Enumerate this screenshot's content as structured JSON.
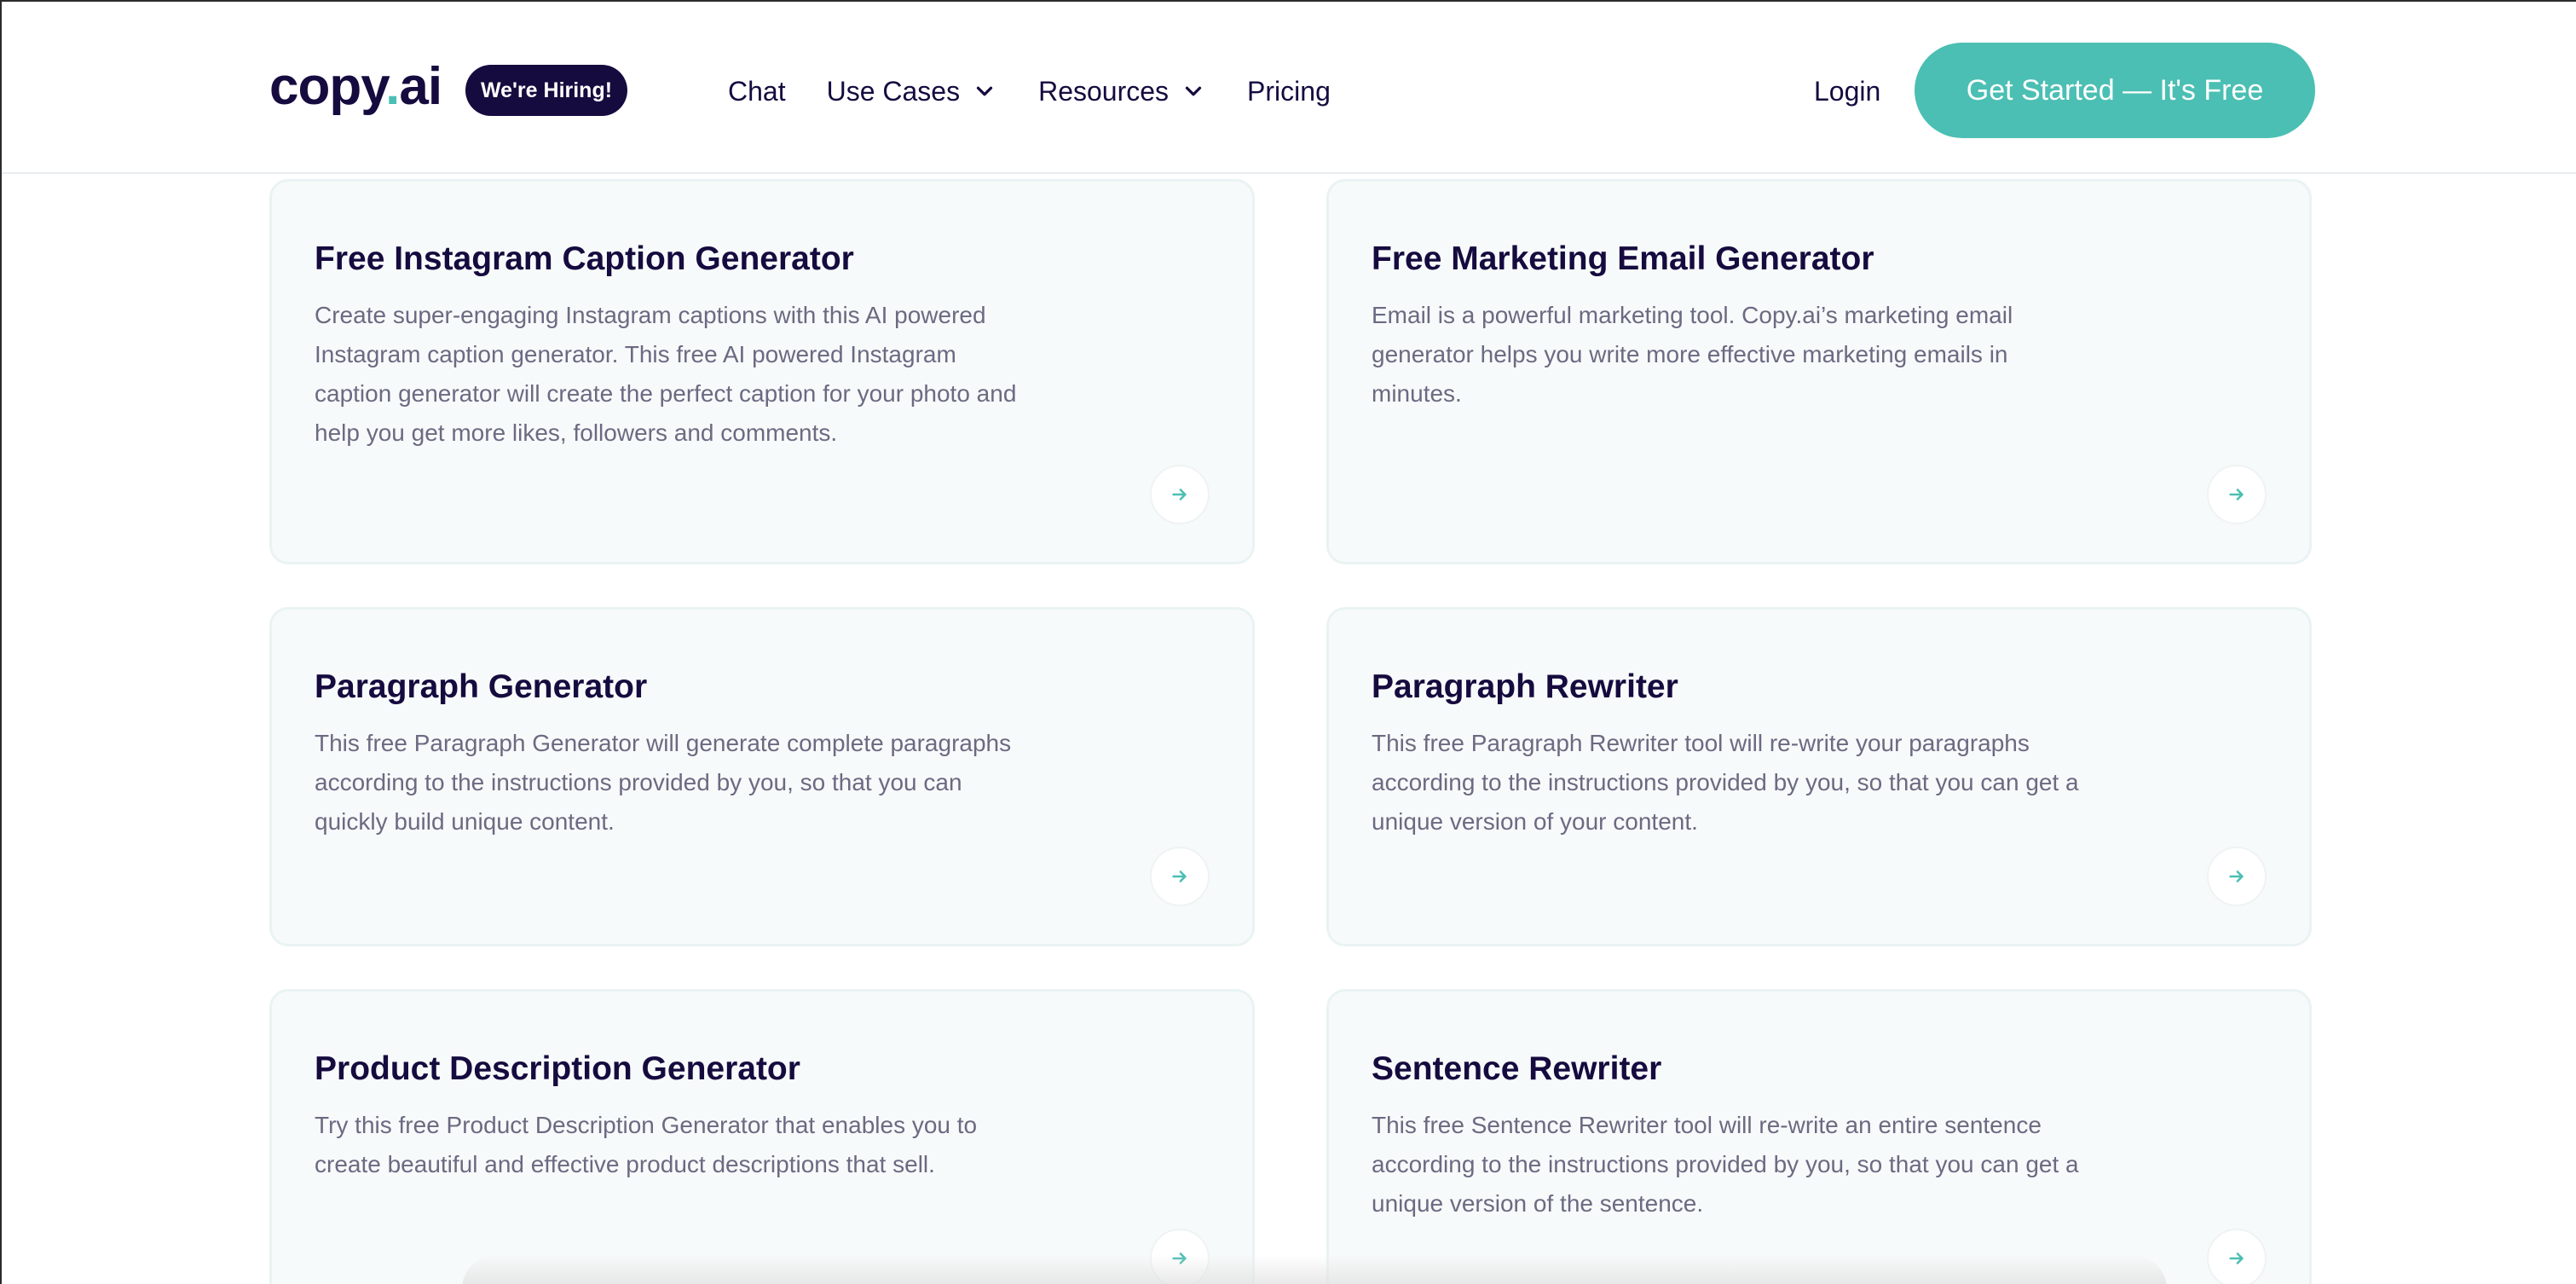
{
  "header": {
    "logo_text_main": "copy",
    "logo_dot": ".",
    "logo_text_tail": "ai",
    "hiring_badge": "We're Hiring!",
    "nav": {
      "chat": "Chat",
      "use_cases": "Use Cases",
      "resources": "Resources",
      "pricing": "Pricing"
    },
    "login": "Login",
    "cta": "Get Started — It's Free"
  },
  "colors": {
    "brand_navy": "#160b3f",
    "accent_teal": "#4bbfb3",
    "card_bg": "#f7fafa",
    "desc_gray": "#6b6a82"
  },
  "icons": {
    "dropdown": "chevron-down-icon",
    "card_link": "arrow-right-icon"
  },
  "cards": [
    {
      "title": "Free Instagram Caption Generator",
      "description": "Create super-engaging Instagram captions with this AI powered Instagram caption generator. This free AI powered Instagram caption generator will create the perfect caption for your photo and help you get more likes, followers and comments."
    },
    {
      "title": "Free Marketing Email Generator",
      "description": "Email is a powerful marketing tool. Copy.ai’s marketing email generator helps you write more effective marketing emails in minutes."
    },
    {
      "title": "Paragraph Generator",
      "description": "This free Paragraph Generator will generate complete paragraphs according to the instructions provided by you, so that you can quickly build unique content."
    },
    {
      "title": "Paragraph Rewriter",
      "description": "This free Paragraph Rewriter tool will re-write your paragraphs according to the instructions provided by you, so that you can get a unique version of your content."
    },
    {
      "title": "Product Description Generator",
      "description": "Try this free Product Description Generator that enables you to create beautiful and effective product descriptions that sell."
    },
    {
      "title": "Sentence Rewriter",
      "description": "This free Sentence Rewriter tool will re-write an entire sentence according to the instructions provided by you, so that you can get a unique version of the sentence."
    }
  ]
}
